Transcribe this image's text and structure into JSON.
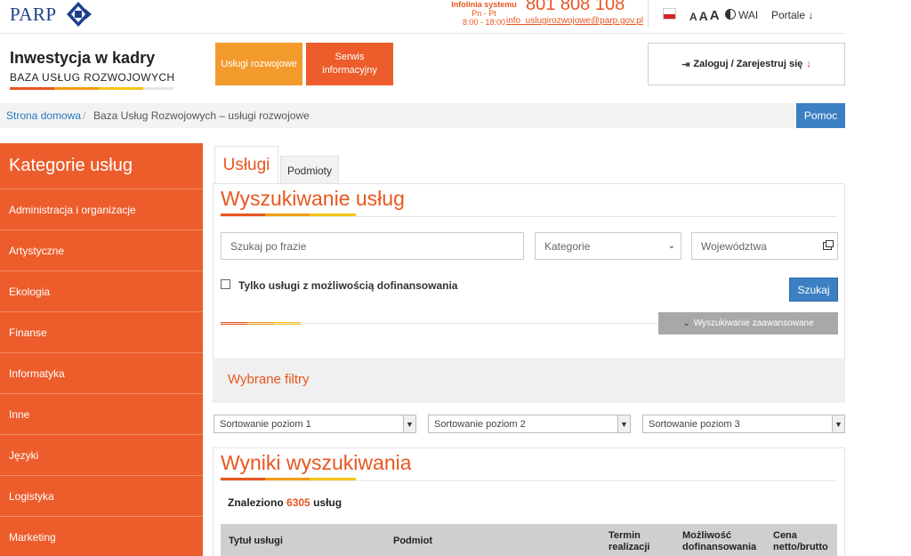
{
  "top": {
    "logo_text": "PARP",
    "infolinia_line1": "Infolinia systemu",
    "infolinia_line2": "Pn - Pt",
    "infolinia_line3": "8:00 - 18:00",
    "phone": "801 808 108",
    "email": "info_uslugirozwojowe@parp.gov.pl",
    "font_a": "A",
    "wai": "WAI",
    "portale": "Portale ↓"
  },
  "brand": {
    "title": "Inwestycja w kadry",
    "subtitle": "BAZA  USŁUG  ROZWOJOWYCH"
  },
  "nav": {
    "btn1": "Usługi rozwojowe",
    "btn2": "Serwis informacyjny",
    "login": "Zaloguj / Zarejestruj się"
  },
  "breadcrumb": {
    "home": "Strona domowa",
    "sep": "/",
    "current": "Baza Usług Rozwojowych – usługi rozwojowe",
    "help": "Pomoc"
  },
  "sidebar": {
    "title": "Kategorie usług",
    "items": [
      "Administracja i organizacje",
      "Artystyczne",
      "Ekologia",
      "Finanse",
      "Informatyka",
      "Inne",
      "Języki",
      "Logistyka",
      "Marketing"
    ]
  },
  "tabs": {
    "active": "Usługi",
    "inactive": "Podmioty"
  },
  "search": {
    "title": "Wyszukiwanie usług",
    "phrase_placeholder": "Szukaj po frazie",
    "category_value": "Kategorie",
    "region_value": "Województwa",
    "checkbox_label": "Tylko usługi z możliwością dofinansowania",
    "search_button": "Szukaj",
    "advanced": "Wyszukiwanie zaawansowane"
  },
  "filters": {
    "title": "Wybrane filtry"
  },
  "sorting": [
    "Sortowanie poziom 1",
    "Sortowanie poziom 2",
    "Sortowanie poziom 3"
  ],
  "results": {
    "title": "Wyniki wyszukiwania",
    "found_prefix": "Znaleziono",
    "found_count": "6305",
    "found_suffix": "usług",
    "columns": [
      "Tytuł usługi",
      "Podmiot",
      "Termin realizacji",
      "Możliwość dofinansowania",
      "Cena netto/brutto"
    ]
  },
  "colors": {
    "accent_orange": "#e8561f",
    "sidebar_orange": "#ec5d2b",
    "button_blue": "#3c7fc3",
    "navy_logo": "#1e3f8a"
  }
}
